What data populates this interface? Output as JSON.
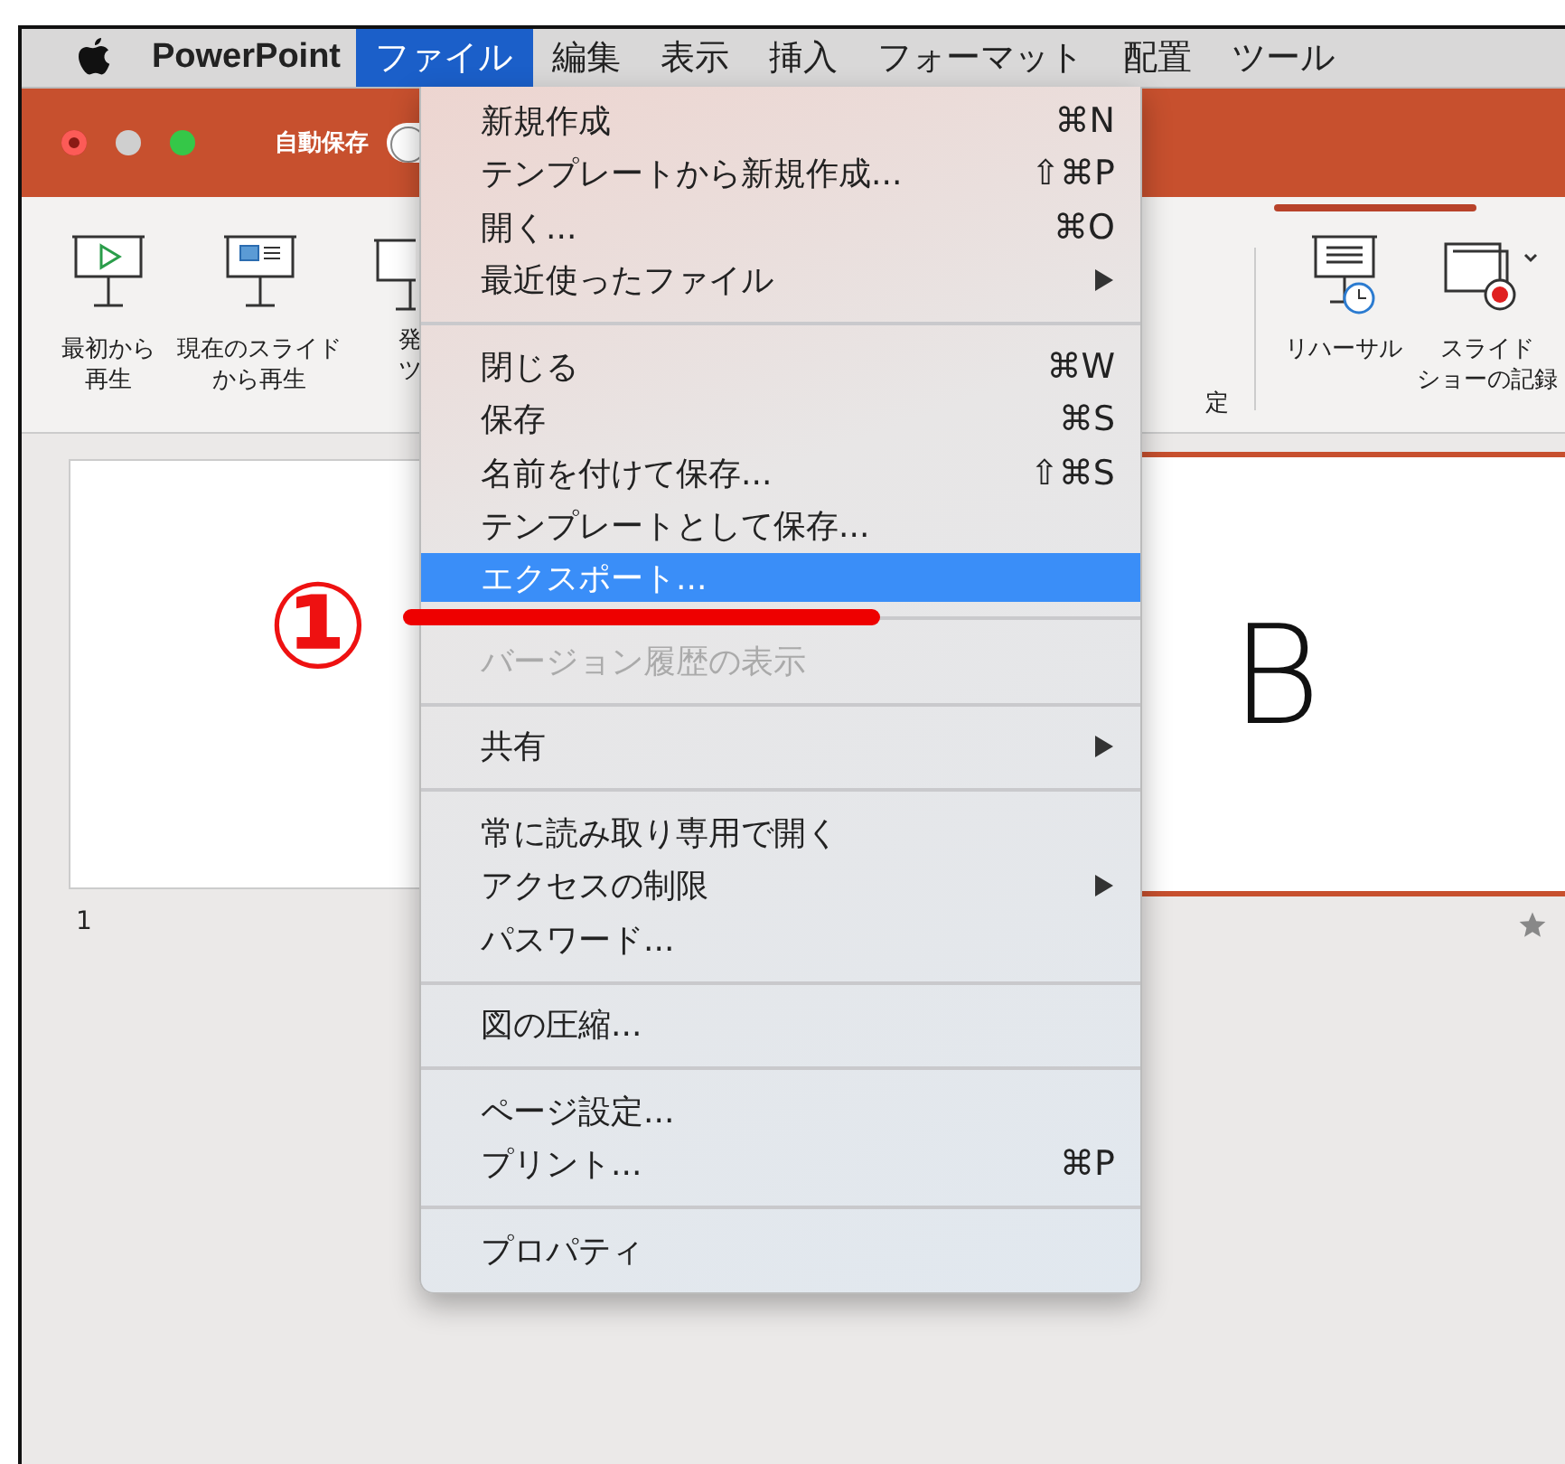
{
  "menu_bar": {
    "app_name": "PowerPoint",
    "menus": [
      {
        "label": "ファイル",
        "selected": true
      },
      {
        "label": "編集",
        "selected": false
      },
      {
        "label": "表示",
        "selected": false
      },
      {
        "label": "挿入",
        "selected": false
      },
      {
        "label": "フォーマット",
        "selected": false
      },
      {
        "label": "配置",
        "selected": false
      },
      {
        "label": "ツール",
        "selected": false
      }
    ]
  },
  "title_bar": {
    "autosave_label": "自動保存",
    "autosave_on": false
  },
  "ribbon": {
    "left_buttons": [
      {
        "kind": "play",
        "lines": [
          "最初から",
          "再生"
        ]
      },
      {
        "kind": "slide",
        "lines": [
          "現在のスライド",
          "から再生"
        ]
      },
      {
        "kind": "cut",
        "lines": [
          "発",
          "ツ"
        ]
      }
    ],
    "partial_label": "定",
    "right_buttons": [
      {
        "kind": "rehearse",
        "lines": [
          "リハーサル"
        ]
      },
      {
        "kind": "record",
        "lines": [
          "スライド",
          "ショーの記録"
        ]
      }
    ]
  },
  "slides": {
    "thumbnail_number": "1",
    "main_text": "B"
  },
  "file_menu": {
    "groups": [
      [
        {
          "label": "新規作成",
          "shortcut": "⌘N",
          "submenu": false,
          "disabled": false,
          "selected": false
        },
        {
          "label": "テンプレートから新規作成...",
          "shortcut": "⇧⌘P",
          "submenu": false,
          "disabled": false,
          "selected": false
        },
        {
          "label": "開く...",
          "shortcut": "⌘O",
          "submenu": false,
          "disabled": false,
          "selected": false
        },
        {
          "label": "最近使ったファイル",
          "submenu": true,
          "disabled": false,
          "selected": false
        }
      ],
      [
        {
          "label": "閉じる",
          "shortcut": "⌘W",
          "submenu": false,
          "disabled": false,
          "selected": false
        },
        {
          "label": "保存",
          "shortcut": "⌘S",
          "submenu": false,
          "disabled": false,
          "selected": false
        },
        {
          "label": "名前を付けて保存...",
          "shortcut": "⇧⌘S",
          "submenu": false,
          "disabled": false,
          "selected": false
        },
        {
          "label": "テンプレートとして保存...",
          "submenu": false,
          "disabled": false,
          "selected": false
        },
        {
          "label": "エクスポート...",
          "submenu": false,
          "disabled": false,
          "selected": true
        }
      ],
      [
        {
          "label": "バージョン履歴の表示",
          "submenu": false,
          "disabled": true,
          "selected": false
        }
      ],
      [
        {
          "label": "共有",
          "submenu": true,
          "disabled": false,
          "selected": false
        }
      ],
      [
        {
          "label": "常に読み取り専用で開く",
          "submenu": false,
          "disabled": false,
          "selected": false
        },
        {
          "label": "アクセスの制限",
          "submenu": true,
          "disabled": false,
          "selected": false
        },
        {
          "label": "パスワード...",
          "submenu": false,
          "disabled": false,
          "selected": false
        }
      ],
      [
        {
          "label": "図の圧縮...",
          "submenu": false,
          "disabled": false,
          "selected": false
        }
      ],
      [
        {
          "label": "ページ設定...",
          "submenu": false,
          "disabled": false,
          "selected": false
        },
        {
          "label": "プリント...",
          "shortcut": "⌘P",
          "submenu": false,
          "disabled": false,
          "selected": false
        }
      ],
      [
        {
          "label": "プロパティ",
          "submenu": false,
          "disabled": false,
          "selected": false
        }
      ]
    ]
  },
  "annotation": {
    "step_number": "①"
  }
}
